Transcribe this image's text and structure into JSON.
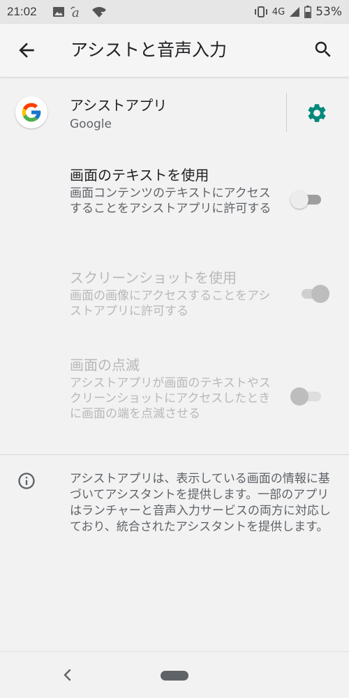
{
  "status_bar": {
    "time": "21:02",
    "network": "4G",
    "battery": "53%",
    "icons": [
      "image-icon",
      "a-icon",
      "wifi-icon",
      "vibrate-icon",
      "signal-icon",
      "battery-icon"
    ]
  },
  "app_bar": {
    "title": "アシストと音声入力",
    "back_icon": "arrow-back-icon",
    "search_icon": "search-icon"
  },
  "assist_app": {
    "title": "アシストアプリ",
    "summary": "Google",
    "settings_icon": "gear-icon"
  },
  "prefs": [
    {
      "title": "画面のテキストを使用",
      "summary": "画面コンテンツのテキストにアクセスすることをアシストアプリに許可する",
      "checked": false,
      "enabled": true
    },
    {
      "title": "スクリーンショットを使用",
      "summary": "画面の画像にアクセスすることをアシストアプリに許可する",
      "checked": true,
      "enabled": false
    },
    {
      "title": "画面の点滅",
      "summary": "アシストアプリが画面のテキストやスクリーンショットにアクセスしたときに画面の端を点滅させる",
      "checked": false,
      "enabled": false
    }
  ],
  "footer": {
    "icon": "info-icon",
    "text": "アシストアプリは、表示している画面の情報に基づいてアシスタントを提供します。一部のアプリはランチャーと音声入力サービスの両方に対応しており、統合されたアシスタントを提供します。"
  },
  "colors": {
    "accent": "#00897b",
    "switch_off_thumb": "#ececec",
    "switch_off_track": "#9e9e9e"
  }
}
